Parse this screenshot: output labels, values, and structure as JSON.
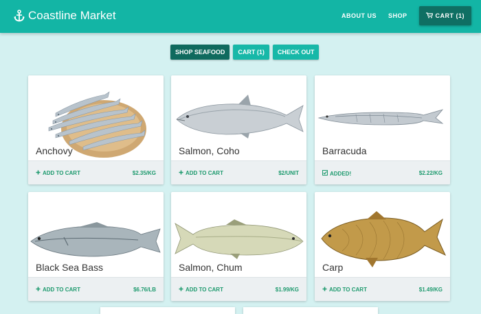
{
  "header": {
    "brand": "Coastline Market",
    "brand_icon": "anchor-icon",
    "nav": {
      "about": "ABOUT US",
      "shop": "SHOP",
      "cart": "CART (1)"
    }
  },
  "actions": {
    "shop": "SHOP SEAFOOD",
    "cart": "CART (1)",
    "checkout": "CHECK OUT"
  },
  "products": [
    {
      "name": "Anchovy",
      "price": "$2.35/KG",
      "action": "ADD TO CART",
      "icon": "plus-icon"
    },
    {
      "name": "Salmon, Coho",
      "price": "$2/UNIT",
      "action": "ADD TO CART",
      "icon": "plus-icon"
    },
    {
      "name": "Barracuda",
      "price": "$2.22/KG",
      "action": "ADDED!",
      "icon": "check-icon"
    },
    {
      "name": "Black Sea Bass",
      "price": "$6.76/LB",
      "action": "ADD TO CART",
      "icon": "plus-icon"
    },
    {
      "name": "Salmon, Chum",
      "price": "$1.99/KG",
      "action": "ADD TO CART",
      "icon": "plus-icon"
    },
    {
      "name": "Carp",
      "price": "$1.49/KG",
      "action": "ADD TO CART",
      "icon": "plus-icon"
    }
  ],
  "colors": {
    "header": "#13b5a5",
    "background": "#d4f1f1",
    "accent_dark": "#0f6a5e",
    "price": "#1e9a6e"
  }
}
